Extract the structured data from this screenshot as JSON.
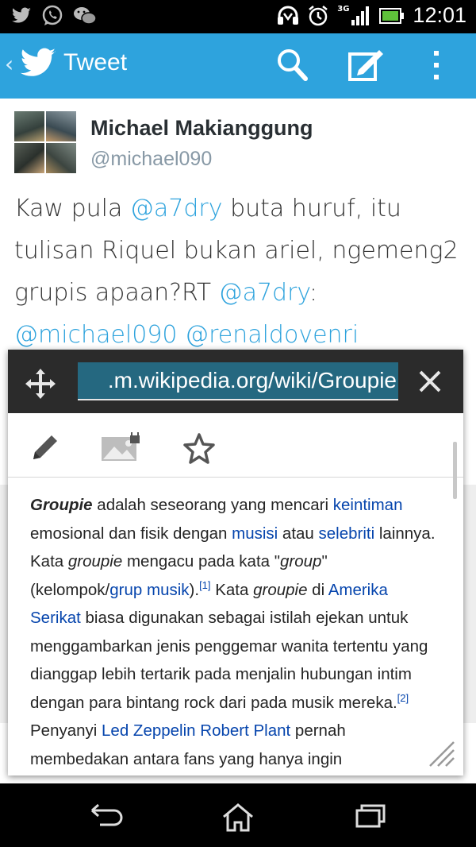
{
  "status_bar": {
    "time": "12:01",
    "network": "3G",
    "left_icons": [
      "twitter-icon",
      "whatsapp-icon",
      "wechat-icon"
    ],
    "right_icons": [
      "headset-icon",
      "alarm-icon",
      "signal-icon",
      "battery-icon"
    ]
  },
  "action_bar": {
    "title": "Tweet",
    "back_glyph": "‹",
    "icons": [
      "twitter-bird-icon",
      "search-icon",
      "compose-icon",
      "overflow-menu-icon"
    ],
    "color": "#2ea3dd"
  },
  "tweet": {
    "author_name": "Michael Makianggung",
    "author_handle": "@michael090",
    "text": {
      "p1": "Kaw pula ",
      "mention1": "@a7dry",
      "p2": " buta huruf, itu tulisan Riquel bukan ariel, ngemeng2 grupis apaan?RT ",
      "mention2": "@a7dry",
      "p3": ": ",
      "mention3": "@michael090",
      "p4": " ",
      "mention4": "@renaldovenri"
    }
  },
  "popup": {
    "url": ".m.wikipedia.org/wiki/Groupie",
    "toolbar_icons": [
      "edit-icon",
      "image-locked-icon",
      "star-icon"
    ],
    "article": {
      "t1": "Groupie",
      "t2": " adalah seseorang yang mencari ",
      "l1": "keintiman",
      "t3": " emosional dan fisik dengan ",
      "l2": "musisi",
      "t4": " atau ",
      "l3": "selebriti",
      "t5": " lainnya. Kata ",
      "t6": "groupie",
      "t7": " mengacu pada kata \"",
      "t8": "group",
      "t9": "\" (kelompok/",
      "l4": "grup musik",
      "t10": ").",
      "ref1": "[1]",
      "t11": " Kata ",
      "t12": "groupie",
      "t13": " di ",
      "l5": "Amerika Serikat",
      "t14": " biasa digunakan sebagai istilah ejekan untuk menggambarkan jenis penggemar wanita tertentu yang dianggap lebih tertarik pada menjalin hubungan intim dengan para bintang rock dari pada musik mereka.",
      "ref2": "[2]",
      "t15": " Penyanyi ",
      "l6": "Led Zeppelin",
      "t16": " ",
      "l7": "Robert Plant",
      "t17": " pernah membedakan antara fans yang hanya ingin"
    }
  },
  "nav_bar": {
    "buttons": [
      "back-button",
      "home-button",
      "recent-apps-button"
    ]
  }
}
